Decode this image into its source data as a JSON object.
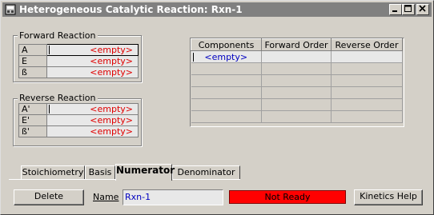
{
  "window": {
    "title": "Heterogeneous Catalytic Reaction: Rxn-1",
    "controls": [
      "minimize-icon",
      "maximize-icon",
      "close-icon"
    ]
  },
  "forward_reaction": {
    "label": "Forward Reaction",
    "rows": [
      {
        "param": "A",
        "value": "<empty>"
      },
      {
        "param": "E",
        "value": "<empty>"
      },
      {
        "param": "ß",
        "value": "<empty>"
      }
    ]
  },
  "reverse_reaction": {
    "label": "Reverse Reaction",
    "rows": [
      {
        "param": "A'",
        "value": "<empty>"
      },
      {
        "param": "E'",
        "value": "<empty>"
      },
      {
        "param": "ß'",
        "value": "<empty>"
      }
    ]
  },
  "components_table": {
    "headers": [
      "Components",
      "Forward Order",
      "Reverse Order"
    ],
    "rows": [
      [
        "<empty>",
        "",
        ""
      ]
    ]
  },
  "tabs": {
    "items": [
      "Stoichiometry",
      "Basis",
      "Numerator",
      "Denominator"
    ],
    "active": "Numerator"
  },
  "footer": {
    "delete_label": "Delete",
    "name_label": "Name",
    "name_value": "Rxn-1",
    "status": "Not Ready",
    "kinetics_help_label": "Kinetics Help"
  },
  "colors": {
    "empty_value": "#e00000",
    "empty_component": "#0000c0",
    "status_bg": "#ff0000",
    "title_bar": "#808080"
  }
}
